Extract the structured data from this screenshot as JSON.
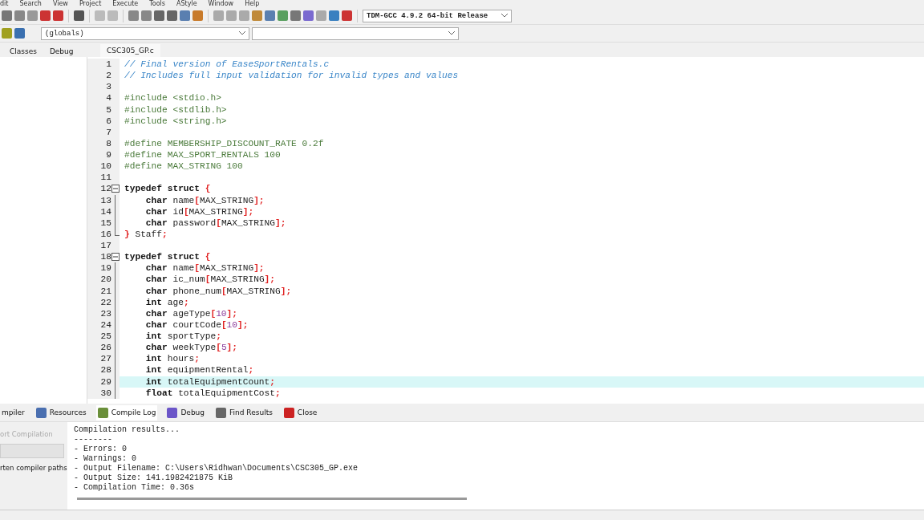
{
  "menu": [
    "dit",
    "Search",
    "View",
    "Project",
    "Execute",
    "Tools",
    "AStyle",
    "Window",
    "Help"
  ],
  "compiler_select": {
    "value": "TDM-GCC 4.9.2 64-bit Release"
  },
  "scope_select": {
    "value": "(globals)"
  },
  "left_tabs": [
    {
      "label": "Classes",
      "selected": false
    },
    {
      "label": "Debug",
      "selected": false
    }
  ],
  "editor_tabs": [
    {
      "label": "CSC305_GP.c",
      "selected": true
    }
  ],
  "code": [
    {
      "number": "1",
      "kind": "plain",
      "tokens": [
        {
          "kind": "comment",
          "text": "// Final version of EaseSportRentals.c"
        }
      ]
    },
    {
      "number": "2",
      "kind": "plain",
      "tokens": [
        {
          "kind": "comment",
          "text": "// Includes full input validation for invalid types and values"
        }
      ]
    },
    {
      "number": "3",
      "kind": "plain"
    },
    {
      "number": "4",
      "kind": "plain",
      "tokens": [
        {
          "kind": "preproc",
          "text": "#include <stdio.h>"
        }
      ]
    },
    {
      "number": "5",
      "kind": "plain",
      "tokens": [
        {
          "kind": "preproc",
          "text": "#include <stdlib.h>"
        }
      ]
    },
    {
      "number": "6",
      "kind": "plain",
      "tokens": [
        {
          "kind": "preproc",
          "text": "#include <string.h>"
        }
      ]
    },
    {
      "number": "7",
      "kind": "plain"
    },
    {
      "number": "8",
      "kind": "plain",
      "tokens": [
        {
          "kind": "preproc",
          "text": "#define MEMBERSHIP_DISCOUNT_RATE 0.2f"
        }
      ]
    },
    {
      "number": "9",
      "kind": "plain",
      "tokens": [
        {
          "kind": "preproc",
          "text": "#define MAX_SPORT_RENTALS 100"
        }
      ]
    },
    {
      "number": "10",
      "kind": "plain",
      "tokens": [
        {
          "kind": "preproc",
          "text": "#define MAX_STRING 100"
        }
      ]
    },
    {
      "number": "11",
      "kind": "plain"
    },
    {
      "number": "12",
      "kind": "open",
      "tokens": [
        {
          "kind": "keyword",
          "text": "typedef struct "
        },
        {
          "kind": "punct",
          "text": "{"
        }
      ]
    },
    {
      "number": "13",
      "kind": "body",
      "tokens": [
        {
          "kind": "keyword",
          "text": "    char "
        },
        {
          "kind": "ident",
          "text": "name"
        },
        {
          "kind": "punct",
          "text": "["
        },
        {
          "kind": "ident",
          "text": "MAX_STRING"
        },
        {
          "kind": "punct",
          "text": "];"
        }
      ]
    },
    {
      "number": "14",
      "kind": "body",
      "tokens": [
        {
          "kind": "keyword",
          "text": "    char "
        },
        {
          "kind": "ident",
          "text": "id"
        },
        {
          "kind": "punct",
          "text": "["
        },
        {
          "kind": "ident",
          "text": "MAX_STRING"
        },
        {
          "kind": "punct",
          "text": "];"
        }
      ]
    },
    {
      "number": "15",
      "kind": "body",
      "tokens": [
        {
          "kind": "keyword",
          "text": "    char "
        },
        {
          "kind": "ident",
          "text": "password"
        },
        {
          "kind": "punct",
          "text": "["
        },
        {
          "kind": "ident",
          "text": "MAX_STRING"
        },
        {
          "kind": "punct",
          "text": "];"
        }
      ]
    },
    {
      "number": "16",
      "kind": "end",
      "tokens": [
        {
          "kind": "punct",
          "text": "} "
        },
        {
          "kind": "ident",
          "text": "Staff"
        },
        {
          "kind": "punct",
          "text": ";"
        }
      ]
    },
    {
      "number": "17",
      "kind": "plain"
    },
    {
      "number": "18",
      "kind": "open",
      "tokens": [
        {
          "kind": "keyword",
          "text": "typedef struct "
        },
        {
          "kind": "punct",
          "text": "{"
        }
      ]
    },
    {
      "number": "19",
      "kind": "body",
      "tokens": [
        {
          "kind": "keyword",
          "text": "    char "
        },
        {
          "kind": "ident",
          "text": "name"
        },
        {
          "kind": "punct",
          "text": "["
        },
        {
          "kind": "ident",
          "text": "MAX_STRING"
        },
        {
          "kind": "punct",
          "text": "];"
        }
      ]
    },
    {
      "number": "20",
      "kind": "body",
      "tokens": [
        {
          "kind": "keyword",
          "text": "    char "
        },
        {
          "kind": "ident",
          "text": "ic_num"
        },
        {
          "kind": "punct",
          "text": "["
        },
        {
          "kind": "ident",
          "text": "MAX_STRING"
        },
        {
          "kind": "punct",
          "text": "];"
        }
      ]
    },
    {
      "number": "21",
      "kind": "body",
      "tokens": [
        {
          "kind": "keyword",
          "text": "    char "
        },
        {
          "kind": "ident",
          "text": "phone_num"
        },
        {
          "kind": "punct",
          "text": "["
        },
        {
          "kind": "ident",
          "text": "MAX_STRING"
        },
        {
          "kind": "punct",
          "text": "];"
        }
      ]
    },
    {
      "number": "22",
      "kind": "body",
      "tokens": [
        {
          "kind": "keyword",
          "text": "    int "
        },
        {
          "kind": "ident",
          "text": "age"
        },
        {
          "kind": "punct",
          "text": ";"
        }
      ]
    },
    {
      "number": "23",
      "kind": "body",
      "tokens": [
        {
          "kind": "keyword",
          "text": "    char "
        },
        {
          "kind": "ident",
          "text": "ageType"
        },
        {
          "kind": "punct",
          "text": "["
        },
        {
          "kind": "number",
          "text": "10"
        },
        {
          "kind": "punct",
          "text": "];"
        }
      ]
    },
    {
      "number": "24",
      "kind": "body",
      "tokens": [
        {
          "kind": "keyword",
          "text": "    char "
        },
        {
          "kind": "ident",
          "text": "courtCode"
        },
        {
          "kind": "punct",
          "text": "["
        },
        {
          "kind": "number",
          "text": "10"
        },
        {
          "kind": "punct",
          "text": "];"
        }
      ]
    },
    {
      "number": "25",
      "kind": "body",
      "tokens": [
        {
          "kind": "keyword",
          "text": "    int "
        },
        {
          "kind": "ident",
          "text": "sportType"
        },
        {
          "kind": "punct",
          "text": ";"
        }
      ]
    },
    {
      "number": "26",
      "kind": "body",
      "tokens": [
        {
          "kind": "keyword",
          "text": "    char "
        },
        {
          "kind": "ident",
          "text": "weekType"
        },
        {
          "kind": "punct",
          "text": "["
        },
        {
          "kind": "number",
          "text": "5"
        },
        {
          "kind": "punct",
          "text": "];"
        }
      ]
    },
    {
      "number": "27",
      "kind": "body",
      "tokens": [
        {
          "kind": "keyword",
          "text": "    int "
        },
        {
          "kind": "ident",
          "text": "hours"
        },
        {
          "kind": "punct",
          "text": ";"
        }
      ]
    },
    {
      "number": "28",
      "kind": "body",
      "tokens": [
        {
          "kind": "keyword",
          "text": "    int "
        },
        {
          "kind": "ident",
          "text": "equipmentRental"
        },
        {
          "kind": "punct",
          "text": ";"
        }
      ]
    },
    {
      "number": "29",
      "kind": "body",
      "selected": true,
      "tokens": [
        {
          "kind": "keyword",
          "text": "    int "
        },
        {
          "kind": "ident",
          "text": "totalEquipmentCount"
        },
        {
          "kind": "punct",
          "text": ";"
        }
      ]
    },
    {
      "number": "30",
      "kind": "body",
      "tokens": [
        {
          "kind": "keyword",
          "text": "    float "
        },
        {
          "kind": "ident",
          "text": "totalEquipmentCost"
        },
        {
          "kind": "punct",
          "text": ";"
        }
      ]
    }
  ],
  "bottom_tabs": [
    {
      "label": "mpiler",
      "selected": false
    },
    {
      "label": "Resources",
      "selected": false
    },
    {
      "label": "Compile Log",
      "selected": true
    },
    {
      "label": "Debug",
      "selected": false
    },
    {
      "label": "Find Results",
      "selected": false
    },
    {
      "label": "Close",
      "selected": false
    }
  ],
  "side_panel": {
    "abort_button": {
      "label": "ort Compilation",
      "disabled": true
    },
    "option_label": "rten compiler paths"
  },
  "compile_log": [
    "Compilation results...",
    "--------",
    "- Errors: 0",
    "- Warnings: 0",
    "- Output Filename: C:\\Users\\Ridhwan\\Documents\\CSC305_GP.exe",
    "- Output Size: 141.1982421875 KiB",
    "- Compilation Time: 0.36s"
  ]
}
